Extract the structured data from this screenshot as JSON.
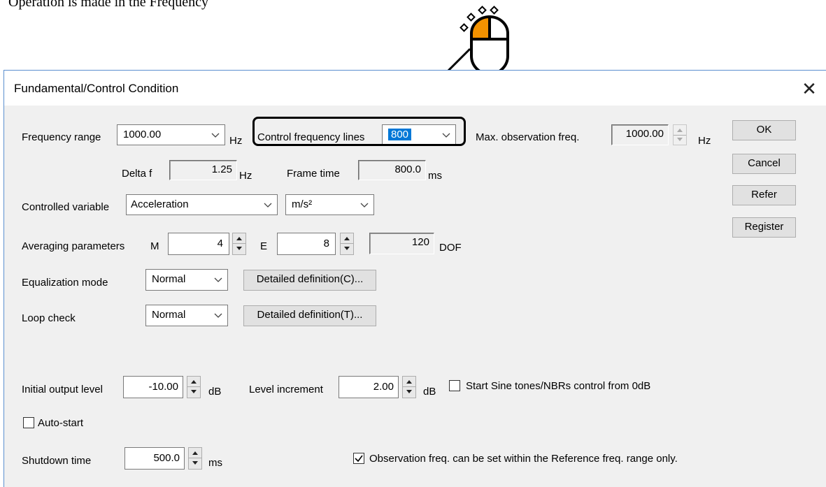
{
  "doc_text": "Operation is made in the Frequency",
  "dialog": {
    "title": "Fundamental/Control Condition",
    "close_glyph": "✕"
  },
  "frequency_range": {
    "label": "Frequency range",
    "value": "1000.00",
    "unit": "Hz"
  },
  "control_frequency_lines": {
    "label": "Control frequency lines",
    "value": "800"
  },
  "max_observation_freq": {
    "label": "Max. observation freq.",
    "value": "1000.00",
    "unit": "Hz"
  },
  "delta_f": {
    "label": "Delta f",
    "value": "1.25",
    "unit": "Hz"
  },
  "frame_time": {
    "label": "Frame time",
    "value": "800.0",
    "unit": "ms"
  },
  "controlled_variable": {
    "label": "Controlled variable",
    "value": "Acceleration",
    "unit_value": "m/s²"
  },
  "averaging": {
    "label": "Averaging parameters",
    "m_label": "M",
    "m_value": "4",
    "e_label": "E",
    "e_value": "8",
    "dof_value": "120",
    "dof_label": "DOF"
  },
  "equalization_mode": {
    "label": "Equalization mode",
    "value": "Normal",
    "button": "Detailed definition(C)..."
  },
  "loop_check": {
    "label": "Loop check",
    "value": "Normal",
    "button": "Detailed definition(T)..."
  },
  "initial_output_level": {
    "label": "Initial output level",
    "value": "-10.00",
    "unit": "dB"
  },
  "level_increment": {
    "label": "Level increment",
    "value": "2.00",
    "unit": "dB"
  },
  "start_sine": {
    "label": "Start Sine tones/NBRs control from 0dB",
    "checked": false
  },
  "auto_start": {
    "label": "Auto-start",
    "checked": false
  },
  "shutdown_time": {
    "label": "Shutdown time",
    "value": "500.0",
    "unit": "ms"
  },
  "observation_range_only": {
    "label": "Observation freq. can be set within the Reference freq. range only.",
    "checked": true
  },
  "buttons": {
    "ok": "OK",
    "cancel": "Cancel",
    "refer": "Refer",
    "register": "Register"
  },
  "colors": {
    "accent": "#0078d7",
    "mouse_button": "#f39200",
    "dialog_bg": "#f0f0f0"
  },
  "icons": {
    "mouse": "mouse-click-icon",
    "dropdown": "chevron-down-icon"
  }
}
